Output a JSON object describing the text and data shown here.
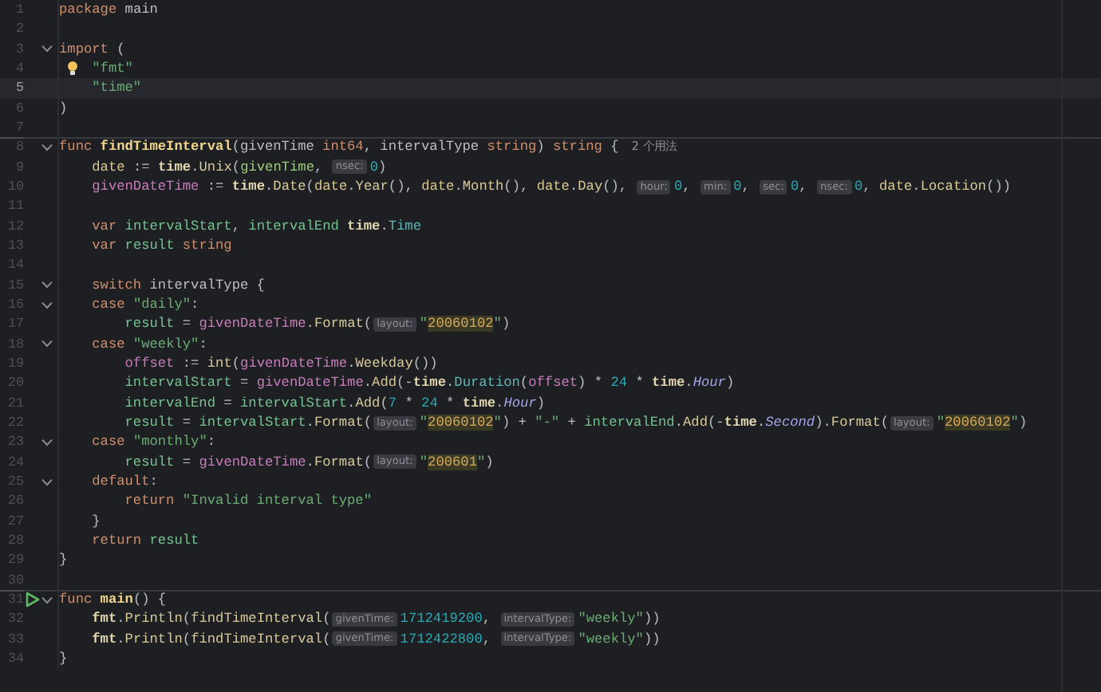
{
  "editor": {
    "lines": [
      {
        "number": "1",
        "fold": false,
        "current": false,
        "separator": false,
        "bulb": false,
        "run": false,
        "tokens": [
          {
            "text": "package",
            "kind": "kw"
          },
          {
            "text": " main",
            "kind": "plain"
          }
        ]
      },
      {
        "number": "2",
        "fold": false,
        "current": false,
        "separator": false,
        "bulb": false,
        "run": false
      },
      {
        "number": "3",
        "fold": true,
        "current": false,
        "separator": false,
        "bulb": false,
        "run": false,
        "tokens": [
          {
            "text": "import",
            "kind": "kw"
          },
          {
            "text": " (",
            "kind": "plain"
          }
        ]
      },
      {
        "number": "4",
        "fold": false,
        "current": false,
        "separator": false,
        "bulb": true,
        "run": false,
        "tokens": [
          {
            "text": "    \"fmt\"",
            "kind": "str"
          }
        ]
      },
      {
        "number": "5",
        "fold": false,
        "current": true,
        "separator": false,
        "bulb": false,
        "run": false,
        "tokens": [
          {
            "text": "    \"time\"",
            "kind": "str"
          }
        ]
      },
      {
        "number": "6",
        "fold": false,
        "current": false,
        "separator": false,
        "bulb": false,
        "run": false,
        "tokens": [
          {
            "text": ")",
            "kind": "plain"
          }
        ]
      },
      {
        "number": "7",
        "fold": false,
        "current": false,
        "separator": false,
        "bulb": false,
        "run": false
      },
      {
        "number": "8",
        "fold": true,
        "current": false,
        "separator": true,
        "bulb": false,
        "run": false,
        "tokens": [
          {
            "text": "func ",
            "kind": "kw"
          },
          {
            "text": "findTimeInterval",
            "kind": "fndecl"
          },
          {
            "text": "(givenTime ",
            "kind": "plain"
          },
          {
            "text": "int64",
            "kind": "kw"
          },
          {
            "text": ", intervalType ",
            "kind": "plain"
          },
          {
            "text": "string",
            "kind": "kw"
          },
          {
            "text": ") ",
            "kind": "plain"
          },
          {
            "text": "string",
            "kind": "kw"
          },
          {
            "text": " {",
            "kind": "plain"
          },
          {
            "text": "2 个用法",
            "kind": "usages"
          }
        ]
      },
      {
        "number": "9",
        "fold": false,
        "current": false,
        "separator": false,
        "bulb": false,
        "run": false,
        "tokens": [
          {
            "text": "    date",
            "kind": "var"
          },
          {
            "text": " := ",
            "kind": "plain"
          },
          {
            "text": "time",
            "kind": "pkg"
          },
          {
            "text": ".",
            "kind": "plain"
          },
          {
            "text": "Unix",
            "kind": "method"
          },
          {
            "text": "(",
            "kind": "plain"
          },
          {
            "text": "givenTime",
            "kind": "param"
          },
          {
            "text": ", ",
            "kind": "plain"
          },
          {
            "text": "nsec:",
            "kind": "hint"
          },
          {
            "text": "0",
            "kind": "num"
          },
          {
            "text": ")",
            "kind": "plain"
          }
        ]
      },
      {
        "number": "10",
        "fold": false,
        "current": false,
        "separator": false,
        "bulb": false,
        "run": false,
        "tokens": [
          {
            "text": "    givenDateTime",
            "kind": "local"
          },
          {
            "text": " := ",
            "kind": "plain"
          },
          {
            "text": "time",
            "kind": "pkg"
          },
          {
            "text": ".",
            "kind": "plain"
          },
          {
            "text": "Date",
            "kind": "method"
          },
          {
            "text": "(",
            "kind": "plain"
          },
          {
            "text": "date",
            "kind": "var"
          },
          {
            "text": ".",
            "kind": "plain"
          },
          {
            "text": "Year",
            "kind": "method"
          },
          {
            "text": "(), ",
            "kind": "plain"
          },
          {
            "text": "date",
            "kind": "var"
          },
          {
            "text": ".",
            "kind": "plain"
          },
          {
            "text": "Month",
            "kind": "method"
          },
          {
            "text": "(), ",
            "kind": "plain"
          },
          {
            "text": "date",
            "kind": "var"
          },
          {
            "text": ".",
            "kind": "plain"
          },
          {
            "text": "Day",
            "kind": "method"
          },
          {
            "text": "(), ",
            "kind": "plain"
          },
          {
            "text": "hour:",
            "kind": "hint"
          },
          {
            "text": "0",
            "kind": "num"
          },
          {
            "text": ", ",
            "kind": "plain"
          },
          {
            "text": "min:",
            "kind": "hint"
          },
          {
            "text": "0",
            "kind": "num"
          },
          {
            "text": ", ",
            "kind": "plain"
          },
          {
            "text": "sec:",
            "kind": "hint"
          },
          {
            "text": "0",
            "kind": "num"
          },
          {
            "text": ", ",
            "kind": "plain"
          },
          {
            "text": "nsec:",
            "kind": "hint"
          },
          {
            "text": "0",
            "kind": "num"
          },
          {
            "text": ", ",
            "kind": "plain"
          },
          {
            "text": "date",
            "kind": "var"
          },
          {
            "text": ".",
            "kind": "plain"
          },
          {
            "text": "Location",
            "kind": "method"
          },
          {
            "text": "())",
            "kind": "plain"
          }
        ]
      },
      {
        "number": "11",
        "fold": false,
        "current": false,
        "separator": false,
        "bulb": false,
        "run": false
      },
      {
        "number": "12",
        "fold": false,
        "current": false,
        "separator": false,
        "bulb": false,
        "run": false,
        "tokens": [
          {
            "text": "    var ",
            "kind": "kw"
          },
          {
            "text": "intervalStart",
            "kind": "green"
          },
          {
            "text": ", ",
            "kind": "plain"
          },
          {
            "text": "intervalEnd ",
            "kind": "green"
          },
          {
            "text": "time",
            "kind": "pkg"
          },
          {
            "text": ".",
            "kind": "plain"
          },
          {
            "text": "Time",
            "kind": "type"
          }
        ]
      },
      {
        "number": "13",
        "fold": false,
        "current": false,
        "separator": false,
        "bulb": false,
        "run": false,
        "tokens": [
          {
            "text": "    var ",
            "kind": "kw"
          },
          {
            "text": "result ",
            "kind": "green"
          },
          {
            "text": "string",
            "kind": "kw"
          }
        ]
      },
      {
        "number": "14",
        "fold": false,
        "current": false,
        "separator": false,
        "bulb": false,
        "run": false
      },
      {
        "number": "15",
        "fold": true,
        "current": false,
        "separator": false,
        "bulb": false,
        "run": false,
        "tokens": [
          {
            "text": "    switch",
            "kind": "kw"
          },
          {
            "text": " intervalType {",
            "kind": "plain"
          }
        ]
      },
      {
        "number": "16",
        "fold": true,
        "current": false,
        "separator": false,
        "bulb": false,
        "run": false,
        "tokens": [
          {
            "text": "    case ",
            "kind": "kw"
          },
          {
            "text": "\"daily\"",
            "kind": "str"
          },
          {
            "text": ":",
            "kind": "plain"
          }
        ]
      },
      {
        "number": "17",
        "fold": false,
        "current": false,
        "separator": false,
        "bulb": false,
        "run": false,
        "tokens": [
          {
            "text": "        result",
            "kind": "green"
          },
          {
            "text": " = ",
            "kind": "plain"
          },
          {
            "text": "givenDateTime",
            "kind": "local"
          },
          {
            "text": ".",
            "kind": "plain"
          },
          {
            "text": "Format",
            "kind": "method"
          },
          {
            "text": "(",
            "kind": "plain"
          },
          {
            "text": "layout:",
            "kind": "hint"
          },
          {
            "text": "\"",
            "kind": "str"
          },
          {
            "text": "20060102",
            "kind": "fmt"
          },
          {
            "text": "\"",
            "kind": "str"
          },
          {
            "text": ")",
            "kind": "plain"
          }
        ]
      },
      {
        "number": "18",
        "fold": true,
        "current": false,
        "separator": false,
        "bulb": false,
        "run": false,
        "tokens": [
          {
            "text": "    case ",
            "kind": "kw"
          },
          {
            "text": "\"weekly\"",
            "kind": "str"
          },
          {
            "text": ":",
            "kind": "plain"
          }
        ]
      },
      {
        "number": "19",
        "fold": false,
        "current": false,
        "separator": false,
        "bulb": false,
        "run": false,
        "tokens": [
          {
            "text": "        offset",
            "kind": "local"
          },
          {
            "text": " := ",
            "kind": "plain"
          },
          {
            "text": "int",
            "kind": "method"
          },
          {
            "text": "(",
            "kind": "plain"
          },
          {
            "text": "givenDateTime",
            "kind": "local"
          },
          {
            "text": ".",
            "kind": "plain"
          },
          {
            "text": "Weekday",
            "kind": "method"
          },
          {
            "text": "())",
            "kind": "plain"
          }
        ]
      },
      {
        "number": "20",
        "fold": false,
        "current": false,
        "separator": false,
        "bulb": false,
        "run": false,
        "tokens": [
          {
            "text": "        intervalStart",
            "kind": "green"
          },
          {
            "text": " = ",
            "kind": "plain"
          },
          {
            "text": "givenDateTime",
            "kind": "local"
          },
          {
            "text": ".",
            "kind": "plain"
          },
          {
            "text": "Add",
            "kind": "method"
          },
          {
            "text": "(-",
            "kind": "plain"
          },
          {
            "text": "time",
            "kind": "pkg"
          },
          {
            "text": ".",
            "kind": "plain"
          },
          {
            "text": "Duration",
            "kind": "type"
          },
          {
            "text": "(",
            "kind": "plain"
          },
          {
            "text": "offset",
            "kind": "local"
          },
          {
            "text": ") * ",
            "kind": "plain"
          },
          {
            "text": "24",
            "kind": "num"
          },
          {
            "text": " * ",
            "kind": "plain"
          },
          {
            "text": "time",
            "kind": "pkg"
          },
          {
            "text": ".",
            "kind": "plain"
          },
          {
            "text": "Hour",
            "kind": "const"
          },
          {
            "text": ")",
            "kind": "plain"
          }
        ]
      },
      {
        "number": "21",
        "fold": false,
        "current": false,
        "separator": false,
        "bulb": false,
        "run": false,
        "tokens": [
          {
            "text": "        intervalEnd",
            "kind": "green"
          },
          {
            "text": " = ",
            "kind": "plain"
          },
          {
            "text": "intervalStart",
            "kind": "green"
          },
          {
            "text": ".",
            "kind": "plain"
          },
          {
            "text": "Add",
            "kind": "method"
          },
          {
            "text": "(",
            "kind": "plain"
          },
          {
            "text": "7",
            "kind": "num"
          },
          {
            "text": " * ",
            "kind": "plain"
          },
          {
            "text": "24",
            "kind": "num"
          },
          {
            "text": " * ",
            "kind": "plain"
          },
          {
            "text": "time",
            "kind": "pkg"
          },
          {
            "text": ".",
            "kind": "plain"
          },
          {
            "text": "Hour",
            "kind": "const"
          },
          {
            "text": ")",
            "kind": "plain"
          }
        ]
      },
      {
        "number": "22",
        "fold": false,
        "current": false,
        "separator": false,
        "bulb": false,
        "run": false,
        "tokens": [
          {
            "text": "        result",
            "kind": "green"
          },
          {
            "text": " = ",
            "kind": "plain"
          },
          {
            "text": "intervalStart",
            "kind": "green"
          },
          {
            "text": ".",
            "kind": "plain"
          },
          {
            "text": "Format",
            "kind": "method"
          },
          {
            "text": "(",
            "kind": "plain"
          },
          {
            "text": "layout:",
            "kind": "hint"
          },
          {
            "text": "\"",
            "kind": "str"
          },
          {
            "text": "20060102",
            "kind": "fmt"
          },
          {
            "text": "\"",
            "kind": "str"
          },
          {
            "text": ") + ",
            "kind": "plain"
          },
          {
            "text": "\"-\"",
            "kind": "str"
          },
          {
            "text": " + ",
            "kind": "plain"
          },
          {
            "text": "intervalEnd",
            "kind": "green"
          },
          {
            "text": ".",
            "kind": "plain"
          },
          {
            "text": "Add",
            "kind": "method"
          },
          {
            "text": "(-",
            "kind": "plain"
          },
          {
            "text": "time",
            "kind": "pkg"
          },
          {
            "text": ".",
            "kind": "plain"
          },
          {
            "text": "Second",
            "kind": "const"
          },
          {
            "text": ").",
            "kind": "plain"
          },
          {
            "text": "Format",
            "kind": "method"
          },
          {
            "text": "(",
            "kind": "plain"
          },
          {
            "text": "layout:",
            "kind": "hint"
          },
          {
            "text": "\"",
            "kind": "str"
          },
          {
            "text": "20060102",
            "kind": "fmt"
          },
          {
            "text": "\"",
            "kind": "str"
          },
          {
            "text": ")",
            "kind": "plain"
          }
        ]
      },
      {
        "number": "23",
        "fold": true,
        "current": false,
        "separator": false,
        "bulb": false,
        "run": false,
        "tokens": [
          {
            "text": "    case ",
            "kind": "kw"
          },
          {
            "text": "\"monthly\"",
            "kind": "str"
          },
          {
            "text": ":",
            "kind": "plain"
          }
        ]
      },
      {
        "number": "24",
        "fold": false,
        "current": false,
        "separator": false,
        "bulb": false,
        "run": false,
        "tokens": [
          {
            "text": "        result",
            "kind": "green"
          },
          {
            "text": " = ",
            "kind": "plain"
          },
          {
            "text": "givenDateTime",
            "kind": "local"
          },
          {
            "text": ".",
            "kind": "plain"
          },
          {
            "text": "Format",
            "kind": "method"
          },
          {
            "text": "(",
            "kind": "plain"
          },
          {
            "text": "layout:",
            "kind": "hint"
          },
          {
            "text": "\"",
            "kind": "str"
          },
          {
            "text": "200601",
            "kind": "fmt"
          },
          {
            "text": "\"",
            "kind": "str"
          },
          {
            "text": ")",
            "kind": "plain"
          }
        ]
      },
      {
        "number": "25",
        "fold": true,
        "current": false,
        "separator": false,
        "bulb": false,
        "run": false,
        "tokens": [
          {
            "text": "    default",
            "kind": "kw"
          },
          {
            "text": ":",
            "kind": "plain"
          }
        ]
      },
      {
        "number": "26",
        "fold": false,
        "current": false,
        "separator": false,
        "bulb": false,
        "run": false,
        "tokens": [
          {
            "text": "        return ",
            "kind": "kw"
          },
          {
            "text": "\"Invalid interval type\"",
            "kind": "str"
          }
        ]
      },
      {
        "number": "27",
        "fold": false,
        "current": false,
        "separator": false,
        "bulb": false,
        "run": false,
        "tokens": [
          {
            "text": "    }",
            "kind": "plain"
          }
        ]
      },
      {
        "number": "28",
        "fold": false,
        "current": false,
        "separator": false,
        "bulb": false,
        "run": false,
        "tokens": [
          {
            "text": "    return ",
            "kind": "kw"
          },
          {
            "text": "result",
            "kind": "green"
          }
        ]
      },
      {
        "number": "29",
        "fold": false,
        "current": false,
        "separator": false,
        "bulb": false,
        "run": false,
        "tokens": [
          {
            "text": "}",
            "kind": "plain"
          }
        ]
      },
      {
        "number": "30",
        "fold": false,
        "current": false,
        "separator": false,
        "bulb": false,
        "run": false
      },
      {
        "number": "31",
        "fold": true,
        "current": false,
        "separator": true,
        "bulb": false,
        "run": true,
        "tokens": [
          {
            "text": "func ",
            "kind": "kw"
          },
          {
            "text": "main",
            "kind": "fndecl"
          },
          {
            "text": "() {",
            "kind": "plain"
          }
        ]
      },
      {
        "number": "32",
        "fold": false,
        "current": false,
        "separator": false,
        "bulb": false,
        "run": false,
        "tokens": [
          {
            "text": "    fmt",
            "kind": "pkg"
          },
          {
            "text": ".",
            "kind": "plain"
          },
          {
            "text": "Println",
            "kind": "method"
          },
          {
            "text": "(",
            "kind": "plain"
          },
          {
            "text": "findTimeInterval",
            "kind": "method"
          },
          {
            "text": "(",
            "kind": "plain"
          },
          {
            "text": "givenTime:",
            "kind": "hint"
          },
          {
            "text": "1712419200",
            "kind": "num"
          },
          {
            "text": ", ",
            "kind": "plain"
          },
          {
            "text": "intervalType:",
            "kind": "hint"
          },
          {
            "text": "\"weekly\"",
            "kind": "str"
          },
          {
            "text": "))",
            "kind": "plain"
          }
        ]
      },
      {
        "number": "33",
        "fold": false,
        "current": false,
        "separator": false,
        "bulb": false,
        "run": false,
        "tokens": [
          {
            "text": "    fmt",
            "kind": "pkg"
          },
          {
            "text": ".",
            "kind": "plain"
          },
          {
            "text": "Println",
            "kind": "method"
          },
          {
            "text": "(",
            "kind": "plain"
          },
          {
            "text": "findTimeInterval",
            "kind": "method"
          },
          {
            "text": "(",
            "kind": "plain"
          },
          {
            "text": "givenTime:",
            "kind": "hint"
          },
          {
            "text": "1712422800",
            "kind": "num"
          },
          {
            "text": ", ",
            "kind": "plain"
          },
          {
            "text": "intervalType:",
            "kind": "hint"
          },
          {
            "text": "\"weekly\"",
            "kind": "str"
          },
          {
            "text": "))",
            "kind": "plain"
          }
        ]
      },
      {
        "number": "34",
        "fold": false,
        "current": false,
        "separator": false,
        "bulb": false,
        "run": false,
        "tokens": [
          {
            "text": "}",
            "kind": "plain"
          }
        ]
      }
    ]
  }
}
